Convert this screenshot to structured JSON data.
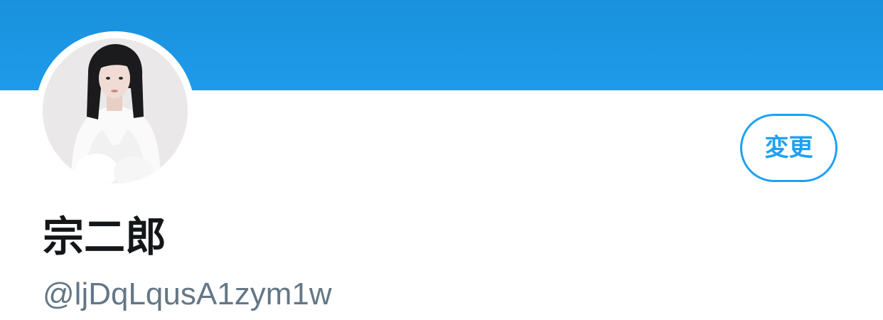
{
  "banner": {
    "color": "#1d9bea"
  },
  "profile": {
    "avatar_icon": "profile-photo",
    "display_name": "宗二郎",
    "handle": "@ljDqLqusA1zym1w"
  },
  "actions": {
    "edit_label": "変更"
  },
  "colors": {
    "accent": "#1da1f2",
    "name_text": "#14171a",
    "handle_text": "#657786"
  }
}
